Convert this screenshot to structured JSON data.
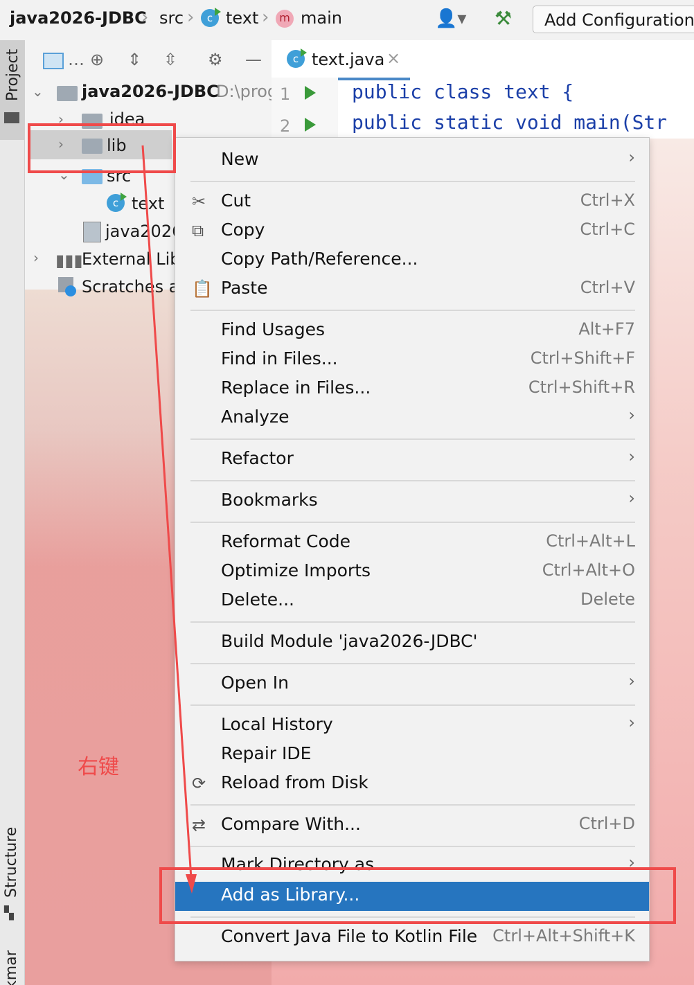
{
  "navbar": {
    "project": "java2026-JDBC",
    "src": "src",
    "class": "text",
    "method": "main",
    "add_configuration": "Add Configuration..."
  },
  "sidebar": {
    "project_tab": "Project",
    "structure_tab": "Structure",
    "bookmarks_tab": "Bookmarks"
  },
  "project_tree": {
    "root_name": "java2026-JDBC",
    "root_path": "D:\\prog",
    "items": [
      {
        "label": "idea"
      },
      {
        "label": "lib"
      },
      {
        "label": "src"
      },
      {
        "label": "text"
      },
      {
        "label": "java2026"
      },
      {
        "label": "External Libr"
      },
      {
        "label": "Scratches ar"
      }
    ]
  },
  "editor": {
    "tab": "text.java",
    "lines": [
      {
        "num": "1",
        "code": "public class text {"
      },
      {
        "num": "2",
        "code": "    public static void main(Str"
      }
    ]
  },
  "context_menu": {
    "items": [
      {
        "label": "New",
        "shortcut": "",
        "submenu": true
      },
      {
        "label": "Cut",
        "shortcut": "Ctrl+X",
        "icon": "scissors-icon"
      },
      {
        "label": "Copy",
        "shortcut": "Ctrl+C",
        "icon": "copy-icon"
      },
      {
        "label": "Copy Path/Reference...",
        "shortcut": ""
      },
      {
        "label": "Paste",
        "shortcut": "Ctrl+V",
        "icon": "paste-icon"
      },
      {
        "label": "Find Usages",
        "shortcut": "Alt+F7"
      },
      {
        "label": "Find in Files...",
        "shortcut": "Ctrl+Shift+F"
      },
      {
        "label": "Replace in Files...",
        "shortcut": "Ctrl+Shift+R"
      },
      {
        "label": "Analyze",
        "shortcut": "",
        "submenu": true
      },
      {
        "label": "Refactor",
        "shortcut": "",
        "submenu": true
      },
      {
        "label": "Bookmarks",
        "shortcut": "",
        "submenu": true
      },
      {
        "label": "Reformat Code",
        "shortcut": "Ctrl+Alt+L"
      },
      {
        "label": "Optimize Imports",
        "shortcut": "Ctrl+Alt+O"
      },
      {
        "label": "Delete...",
        "shortcut": "Delete"
      },
      {
        "label": "Build Module 'java2026-JDBC'",
        "shortcut": ""
      },
      {
        "label": "Open In",
        "shortcut": "",
        "submenu": true
      },
      {
        "label": "Local History",
        "shortcut": "",
        "submenu": true
      },
      {
        "label": "Repair IDE",
        "shortcut": ""
      },
      {
        "label": "Reload from Disk",
        "shortcut": "",
        "icon": "reload-icon"
      },
      {
        "label": "Compare With...",
        "shortcut": "Ctrl+D",
        "icon": "compare-icon"
      },
      {
        "label": "Mark Directory as",
        "shortcut": "",
        "submenu": true
      },
      {
        "label": "Add as Library...",
        "shortcut": "",
        "selected": true
      },
      {
        "label": "Convert Java File to Kotlin File",
        "shortcut": "Ctrl+Alt+Shift+K"
      }
    ]
  },
  "annotation": {
    "note": "右键",
    "color": "#ef4a4a"
  },
  "colors": {
    "selection": "#2675bf",
    "keyword": "#1b3fa8"
  }
}
